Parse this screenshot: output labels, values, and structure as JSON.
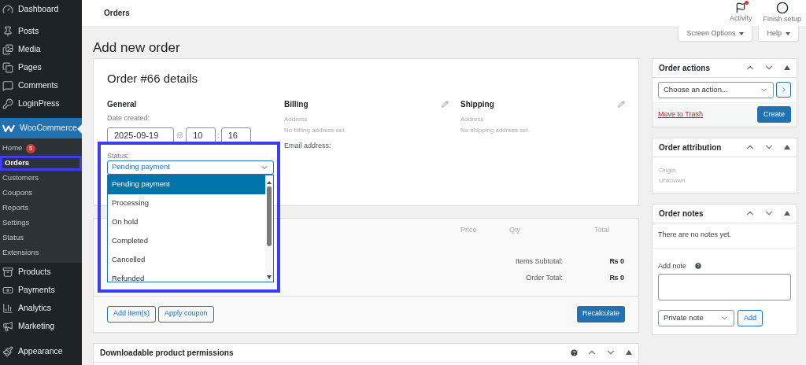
{
  "top_bar": {
    "title": "Orders",
    "actions": [
      {
        "label": "Activity",
        "unread": true
      },
      {
        "label": "Finish setup",
        "unread": false
      }
    ]
  },
  "screen_tabs": [
    "Screen Options",
    "Help"
  ],
  "sidebar": {
    "items": [
      {
        "label": "Dashboard",
        "selected": false
      },
      {
        "label": "Posts",
        "selected": false
      },
      {
        "label": "Media",
        "selected": false
      },
      {
        "label": "Pages",
        "selected": false
      },
      {
        "label": "Comments",
        "selected": false
      },
      {
        "label": "LoginPress",
        "selected": false
      },
      {
        "label": "WooCommerce",
        "selected": true,
        "children": [
          {
            "label": "Home",
            "selected": false,
            "highlighted": false,
            "count": "5"
          },
          {
            "label": "Orders",
            "selected": true,
            "highlighted": true
          },
          {
            "label": "Customers",
            "selected": false,
            "highlighted": false
          },
          {
            "label": "Coupons",
            "selected": false,
            "highlighted": false
          },
          {
            "label": "Reports",
            "selected": false,
            "highlighted": false
          },
          {
            "label": "Settings",
            "selected": false,
            "highlighted": false
          },
          {
            "label": "Status",
            "selected": false,
            "highlighted": false
          },
          {
            "label": "Extensions",
            "selected": false,
            "highlighted": false
          }
        ]
      },
      {
        "label": "Products",
        "selected": false
      },
      {
        "label": "Payments",
        "selected": false
      },
      {
        "label": "Analytics",
        "selected": false
      },
      {
        "label": "Marketing",
        "selected": false
      },
      {
        "label": "Appearance",
        "selected": false
      }
    ]
  },
  "page_title": "Add new order",
  "order": {
    "title": "Order #66 details",
    "general": {
      "heading": "General",
      "date_label": "Date created:",
      "date": "2025-09-19",
      "at": "@",
      "hour": "10",
      "separator": ":",
      "minute": "16"
    },
    "status": {
      "label": "Status:",
      "value": "Pending payment",
      "open": true,
      "highlighted": true,
      "options": [
        {
          "label": "Pending payment",
          "selected": true
        },
        {
          "label": "Processing",
          "selected": false
        },
        {
          "label": "On hold",
          "selected": false
        },
        {
          "label": "Completed",
          "selected": false
        },
        {
          "label": "Cancelled",
          "selected": false
        },
        {
          "label": "Refunded",
          "selected": false
        }
      ]
    },
    "billing": {
      "heading": "Billing",
      "lines": [
        "Address",
        "No billing address set."
      ],
      "email_label": "Email address:"
    },
    "shipping": {
      "heading": "Shipping",
      "lines": [
        "Address",
        "No shipping address set."
      ]
    }
  },
  "items": {
    "columns": [
      "Price",
      "Qty",
      "Total"
    ],
    "totals": [
      {
        "label": "Items Subtotal:",
        "value": "₨ 0"
      },
      {
        "label": "Order Total:",
        "value": "₨ 0"
      }
    ],
    "buttons": [
      "Add item(s)",
      "Apply coupon"
    ],
    "recalculate": "Recalculate"
  },
  "downloads": {
    "title": "Downloadable product permissions"
  },
  "order_actions": {
    "title": "Order actions",
    "placeholder": "Choose an action...",
    "trash": "Move to Trash",
    "create": "Create"
  },
  "order_attribution": {
    "title": "Order attribution",
    "lines": [
      "Origin",
      "Unknown"
    ]
  },
  "order_notes": {
    "title": "Order notes",
    "empty": "There are no notes yet.",
    "add_label": "Add note",
    "note_type": "Private note",
    "add": "Add"
  }
}
